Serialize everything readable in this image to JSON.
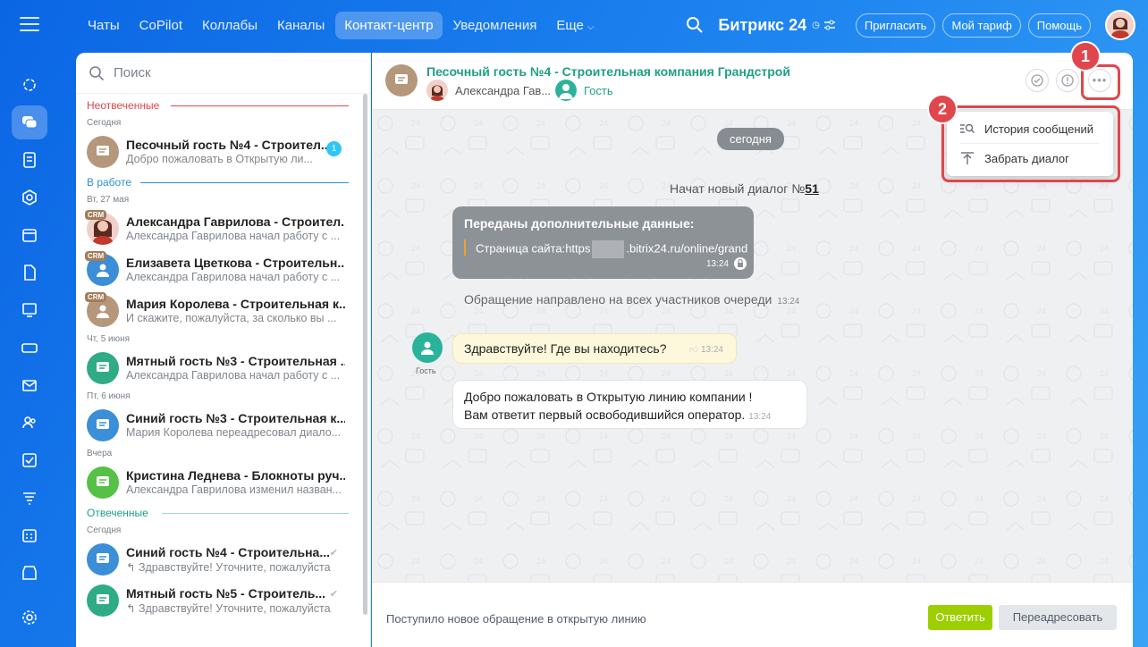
{
  "topnav": {
    "tabs": [
      "Чаты",
      "CoPilot",
      "Коллабы",
      "Каналы",
      "Контакт-центр",
      "Уведомления",
      "Еще"
    ],
    "active_index": 4
  },
  "topright": {
    "brand": "Битрикс",
    "brand_num": "24",
    "invite": "Пригласить",
    "tariff": "Мой тариф",
    "help": "Помощь"
  },
  "sidebar": {
    "search_placeholder": "Поиск",
    "sections": {
      "unanswered": "Неотвеченные",
      "in_work": "В работе",
      "answered": "Отвеченные"
    },
    "dates": {
      "today": "Сегодня",
      "tue": "Вт, 27 мая",
      "thu": "Чт, 5 июня",
      "fri": "Пт, 6 июня",
      "yesterday": "Вчера",
      "today2": "Сегодня"
    },
    "chats": [
      {
        "name": "Песочный гость №4 - Строител...",
        "preview": "Добро пожаловать в Открытую ли...",
        "badge": "1"
      },
      {
        "crm": "CRM",
        "name": "Александра Гаврилова - Строител...",
        "preview": "Александра Гаврилова начал работу с ..."
      },
      {
        "crm": "CRM",
        "name": "Елизавета Цветкова - Строительн...",
        "preview": "Александра Гаврилова начал работу с ..."
      },
      {
        "crm": "CRM",
        "name": "Мария Королева - Строительная к...",
        "preview": "И скажите, пожалуйста, за сколько вы ..."
      },
      {
        "name": "Мятный гость №3 - Строительная ...",
        "preview": "Александра Гаврилова начал работу с ..."
      },
      {
        "name": "Синий гость №3 - Строительная к...",
        "preview": "Мария Королева переадресовал диало..."
      },
      {
        "name": "Кристина Леднева - Блокноты руч...",
        "preview": "Александра Гаврилова изменил назван..."
      },
      {
        "name": "Синий гость №4 - Строительна...",
        "preview": "Здравствуйте! Уточните, пожалуйста"
      },
      {
        "name": "Мятный гость №5 - Строитель...",
        "preview": "Здравствуйте! Уточните, пожалуйста"
      }
    ]
  },
  "chat": {
    "title": "Песочный гость №4 - Строительная компания Грандстрой",
    "member1": "Александра Гав...",
    "member2": "Гость",
    "date_chip": "сегодня",
    "new_dialog": "Начат новый диалог №",
    "dialog_num": "51",
    "data_title": "Переданы дополнительные данные:",
    "data_page_label": "Страница сайта:",
    "data_url_start": "https",
    "data_url_end": ".bitrix24.ru/online/grand",
    "data_time": "13:24",
    "routed_text": "Обращение направлено на всех участников очереди",
    "routed_time": "13:24",
    "guest_label": "Гость",
    "msg1": "Здравствуйте! Где вы находитесь?",
    "msg1_time": "13:24",
    "msg2_line1": "Добро пожаловать в Открытую линию компании !",
    "msg2_line2": "Вам ответит первый освободившийся оператор.",
    "msg2_time": "13:24"
  },
  "footer": {
    "text": "Поступило новое обращение в открытую линию",
    "reply": "Ответить",
    "forward": "Переадресовать"
  },
  "menu": {
    "history": "История сообщений",
    "take": "Забрать диалог"
  },
  "markers": {
    "one": "1",
    "two": "2"
  },
  "colors": {
    "accent": "#1f9f85",
    "annotation": "#e0474c",
    "reply_button": "#9dcf00",
    "unanswered": "#e0474c",
    "in_work": "#2f8fd8",
    "answered": "#1f9f85"
  }
}
